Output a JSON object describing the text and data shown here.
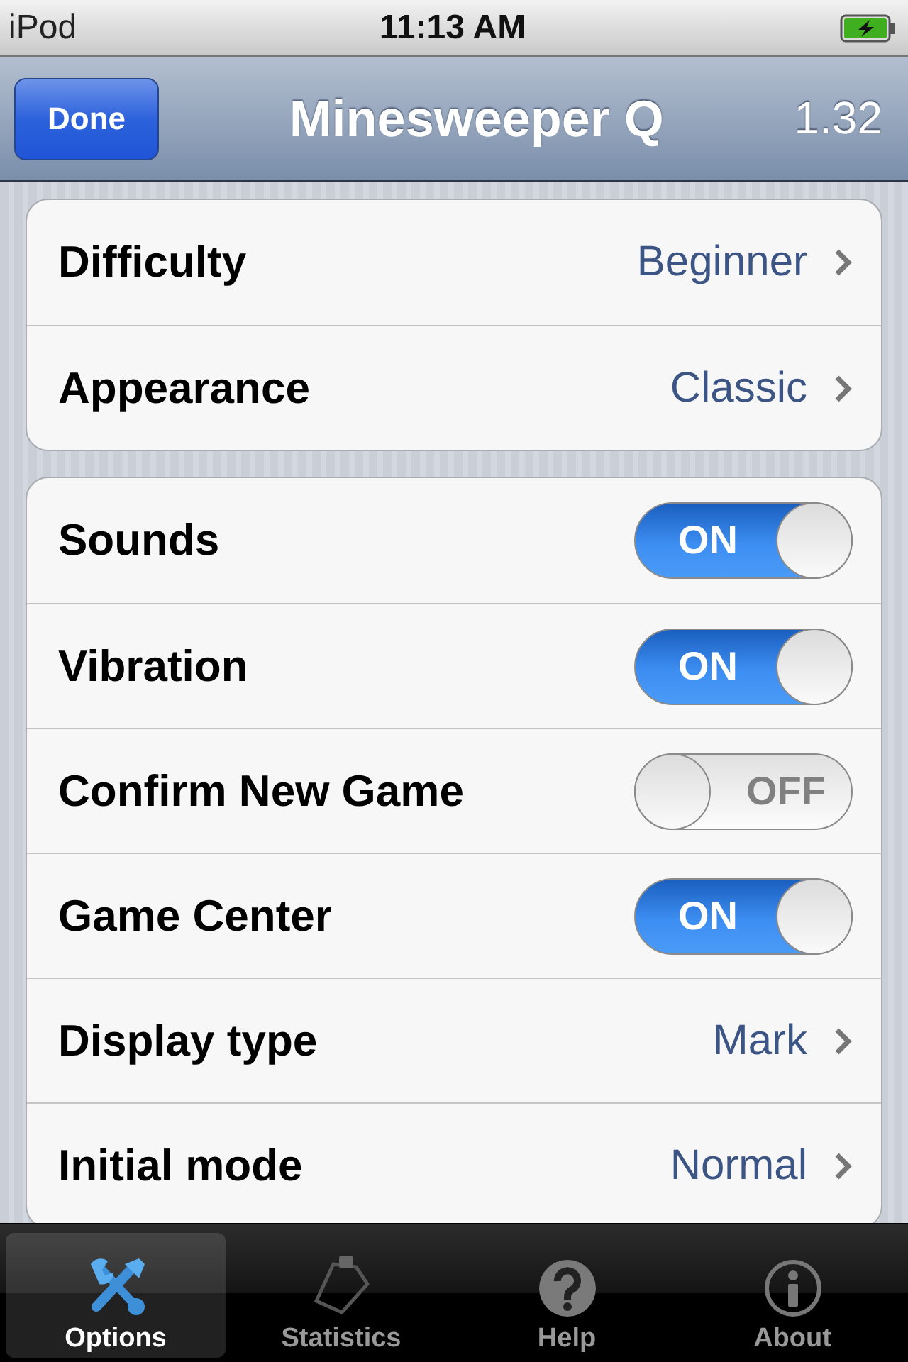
{
  "status_bar": {
    "carrier": "iPod",
    "time": "11:13 AM",
    "charging": true
  },
  "nav_bar": {
    "button": "Done",
    "title": "Minesweeper Q",
    "version": "1.32"
  },
  "groups": [
    {
      "rows": [
        {
          "kind": "disclosure",
          "label": "Difficulty",
          "value": "Beginner"
        },
        {
          "kind": "disclosure",
          "label": "Appearance",
          "value": "Classic"
        }
      ]
    },
    {
      "rows": [
        {
          "kind": "switch",
          "label": "Sounds",
          "on": true,
          "switch_text": "ON"
        },
        {
          "kind": "switch",
          "label": "Vibration",
          "on": true,
          "switch_text": "ON"
        },
        {
          "kind": "switch",
          "label": "Confirm New Game",
          "on": false,
          "switch_text": "OFF"
        },
        {
          "kind": "switch",
          "label": "Game Center",
          "on": true,
          "switch_text": "ON"
        },
        {
          "kind": "disclosure",
          "label": "Display type",
          "value": "Mark"
        },
        {
          "kind": "disclosure",
          "label": "Initial mode",
          "value": "Normal"
        }
      ]
    }
  ],
  "tabs": [
    {
      "label": "Options",
      "selected": true
    },
    {
      "label": "Statistics",
      "selected": false
    },
    {
      "label": "Help",
      "selected": false
    },
    {
      "label": "About",
      "selected": false
    }
  ]
}
